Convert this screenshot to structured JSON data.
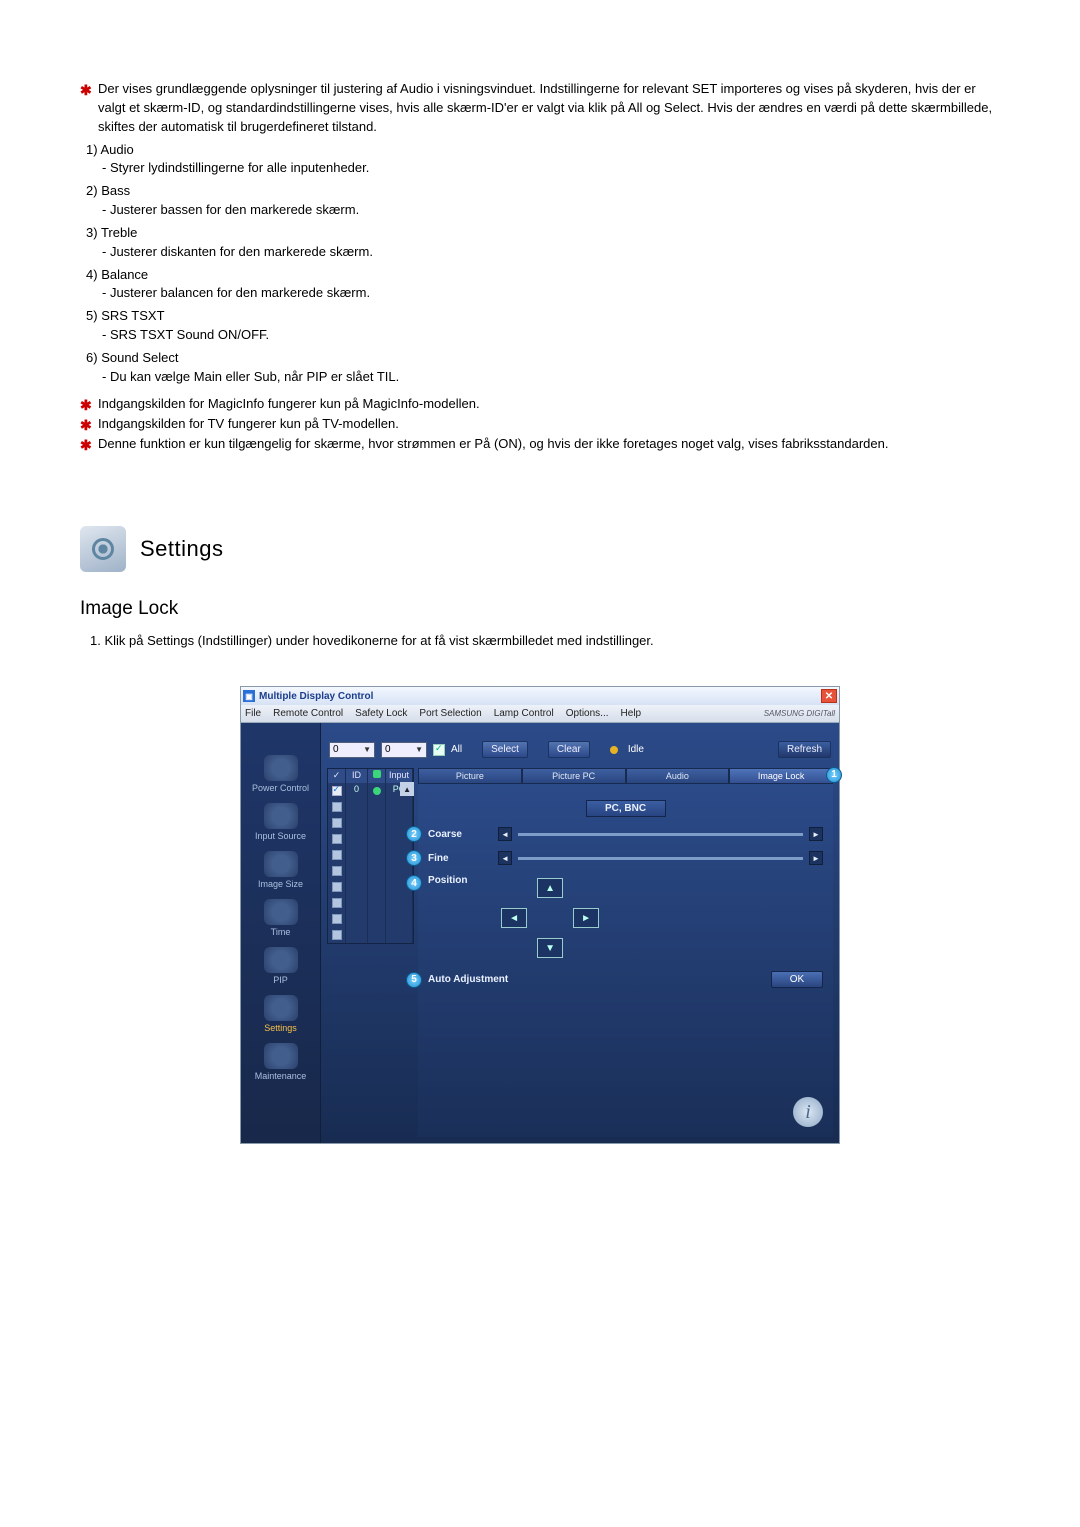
{
  "intro": {
    "star_note": "Der vises grundlæggende oplysninger til justering af Audio i visningsvinduet. Indstillingerne for relevant SET importeres og vises på skyderen, hvis der er valgt et skærm-ID, og standardindstillingerne vises, hvis alle skærm-ID'er er valgt via klik på All og Select. Hvis der ændres en værdi på dette skærmbillede, skiftes der automatisk til brugerdefineret tilstand."
  },
  "list": [
    {
      "num": "1)",
      "title": "Audio",
      "desc": "- Styrer lydindstillingerne for alle inputenheder."
    },
    {
      "num": "2)",
      "title": "Bass",
      "desc": "- Justerer bassen for den markerede skærm."
    },
    {
      "num": "3)",
      "title": "Treble",
      "desc": "- Justerer diskanten for den markerede skærm."
    },
    {
      "num": "4)",
      "title": "Balance",
      "desc": "- Justerer balancen for den markerede skærm."
    },
    {
      "num": "5)",
      "title": "SRS TSXT",
      "desc": "- SRS TSXT Sound ON/OFF."
    },
    {
      "num": "6)",
      "title": "Sound Select",
      "desc": "- Du kan vælge Main eller Sub, når PIP er slået TIL."
    }
  ],
  "notes": [
    "Indgangskilden for MagicInfo fungerer kun på MagicInfo-modellen.",
    "Indgangskilden for TV fungerer kun på TV-modellen.",
    "Denne funktion er kun tilgængelig for skærme, hvor strømmen er På (ON), og hvis der ikke foretages noget valg, vises fabriksstandarden."
  ],
  "section": {
    "title": "Settings",
    "subtitle": "Image Lock",
    "instruction_num": "1.",
    "instruction": "Klik på Settings (Indstillinger) under hovedikonerne for at få vist skærmbilledet med indstillinger."
  },
  "app": {
    "title": "Multiple Display Control",
    "menu": [
      "File",
      "Remote Control",
      "Safety Lock",
      "Port Selection",
      "Lamp Control",
      "Options...",
      "Help"
    ],
    "brand": "SAMSUNG DIGITall",
    "leftRail": [
      {
        "label": "Power Control"
      },
      {
        "label": "Input Source"
      },
      {
        "label": "Image Size"
      },
      {
        "label": "Time"
      },
      {
        "label": "PIP"
      },
      {
        "label": "Settings",
        "active": true
      },
      {
        "label": "Maintenance"
      }
    ],
    "toolbar": {
      "select1": "0",
      "select2": "0",
      "all": "All",
      "btnSelect": "Select",
      "btnClear": "Clear",
      "idle": "Idle",
      "btnRefresh": "Refresh"
    },
    "grid": {
      "headers": {
        "chk": "✓",
        "id": "ID",
        "st": "",
        "input": "Input"
      },
      "rows": [
        {
          "id": "0",
          "input": "PC",
          "status": "on",
          "checked": true
        }
      ],
      "emptyRowCount": 9
    },
    "tabs": [
      "Picture",
      "Picture PC",
      "Audio",
      "Image Lock"
    ],
    "activeTab": 3,
    "mode": "PC, BNC",
    "controls": {
      "coarse": "Coarse",
      "fine": "Fine",
      "position": "Position",
      "auto": "Auto Adjustment",
      "ok": "OK"
    },
    "callouts": {
      "tab": "1",
      "coarse": "2",
      "fine": "3",
      "position": "4",
      "auto": "5"
    }
  }
}
